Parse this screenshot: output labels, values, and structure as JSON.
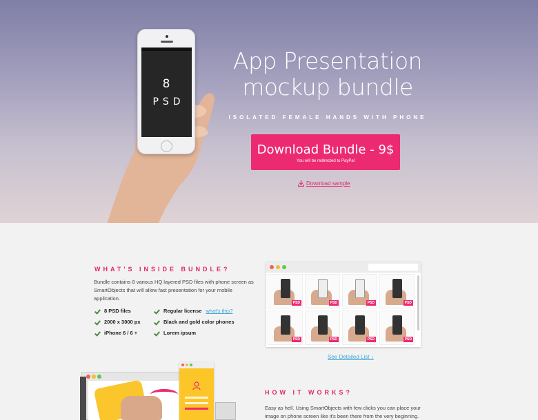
{
  "hero": {
    "title_line1": "App Presentation",
    "title_line2": "mockup bundle",
    "subtitle": "ISOLATED FEMALE HANDS WITH PHONE",
    "phone_screen_number": "8",
    "phone_screen_text": "PSD",
    "download_button_label": "Download Bundle - 9$",
    "download_button_note": "You will be redirected to PayPal",
    "download_sample_label": "Download sample"
  },
  "inside": {
    "heading": "WHAT'S INSIDE BUNDLE?",
    "description": "Bundle contains 8 various HQ layered PSD files with phone screen as SmartObjects that will allow fast presentation for your mobile application.",
    "features_left": [
      "8 PSD files",
      "2000 x 3000 px",
      "iPhone 6 / 6 +"
    ],
    "features_right": [
      "Regular license",
      "Black and gold color phones",
      "Lorem ipsum"
    ],
    "license_link": "what's this?",
    "thumb_badge": "PSD",
    "see_list_label": "See Detailed List",
    "colors": {
      "accent": "#ec2a72",
      "link": "#3aa4d8",
      "check": "#4a8a3c"
    }
  },
  "how": {
    "heading": "HOW IT WORKS?",
    "description": "Easy as hell. Using SmartObjects with few clicks you can place your image on phone screen like it's been there from the very beginning."
  }
}
